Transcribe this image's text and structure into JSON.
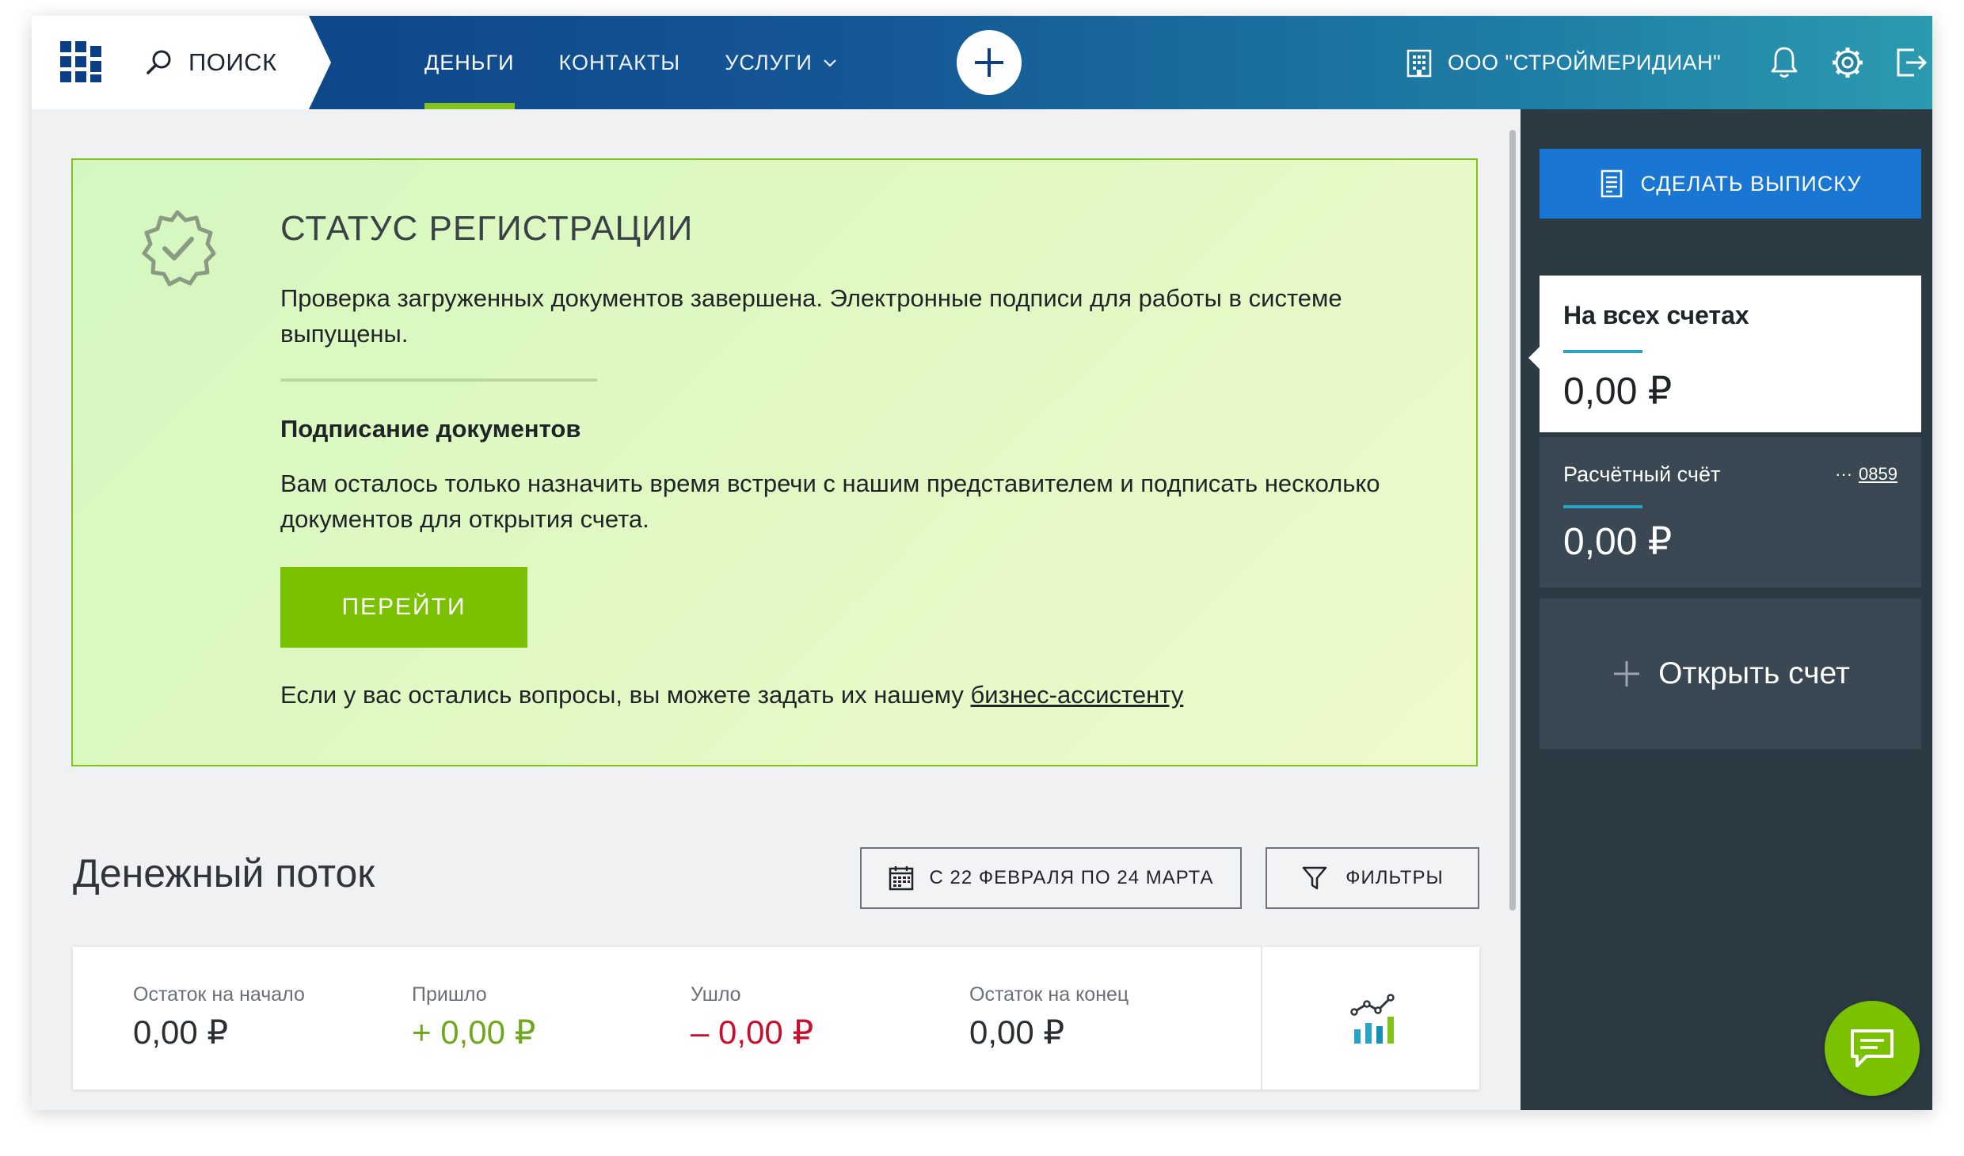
{
  "header": {
    "search_label": "ПОИСК",
    "nav": [
      {
        "label": "ДЕНЬГИ",
        "active": true
      },
      {
        "label": "КОНТАКТЫ",
        "active": false
      },
      {
        "label": "УСЛУГИ",
        "active": false
      }
    ],
    "company": "ООО \"СТРОЙМЕРИДИАН\"",
    "icons": [
      "logo-icon",
      "search-icon",
      "chevron-down-icon",
      "plus-icon",
      "building-icon",
      "bell-icon",
      "gear-icon",
      "logout-icon"
    ]
  },
  "registration": {
    "title": "СТАТУС РЕГИСТРАЦИИ",
    "text": "Проверка загруженных документов завершена. Электронные подписи для работы в системе выпущены.",
    "subtitle": "Подписание документов",
    "text2": "Вам осталось только назначить время встречи с нашим представителем и подписать несколько документов  для открытия счета.",
    "button": "ПЕРЕЙТИ",
    "help_prefix": "Если у вас остались вопросы, вы можете задать их нашему ",
    "help_link": "бизнес-ассистенту"
  },
  "cashflow": {
    "title": "Денежный поток",
    "date_range": "С 22 ФЕВРАЛЯ ПО 24 МАРТА",
    "filters": "ФИЛЬТРЫ",
    "summary": [
      {
        "label": "Остаток на начало",
        "value": "0,00 ₽"
      },
      {
        "label": "Пришло",
        "value": "+ 0,00 ₽"
      },
      {
        "label": "Ушло",
        "value": "– 0,00 ₽"
      },
      {
        "label": "Остаток на конец",
        "value": "0,00 ₽"
      }
    ]
  },
  "sidebar": {
    "statement_button": "СДЕЛАТЬ ВЫПИСКУ",
    "all_accounts": {
      "title": "На всех счетах",
      "value": "0,00 ₽"
    },
    "current_account": {
      "title": "Расчётный счёт",
      "number_prefix": "···",
      "number": "0859",
      "value": "0,00 ₽"
    },
    "open_account": "Открыть счет"
  },
  "colors": {
    "header_start": "#0b3e84",
    "header_end": "#2b9bb0",
    "accent_green": "#7ac200",
    "primary_blue": "#1976d2",
    "sidebar_bg": "#2c3a44",
    "positive": "#6fa81e",
    "negative": "#c8102e"
  }
}
